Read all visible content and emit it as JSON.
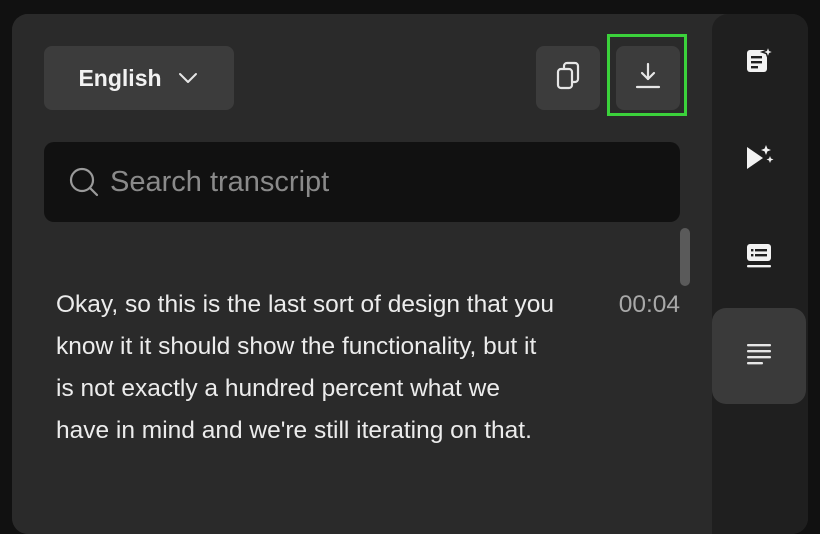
{
  "header": {
    "language_label": "English",
    "language_dropdown_icon": "chevron-down-icon",
    "copy_icon": "copy-icon",
    "download_icon": "download-icon"
  },
  "search": {
    "placeholder": "Search transcript",
    "value": "",
    "icon": "search-icon"
  },
  "transcript": {
    "entries": [
      {
        "text": "Okay, so this is the last sort of design that you know it it should show the functionality, but it is not exactly a hundred percent what we have in mind and we're still iterating on that.",
        "timestamp": "00:04"
      }
    ]
  },
  "side_rail": {
    "items": [
      {
        "icon": "ai-notes-icon",
        "active": false
      },
      {
        "icon": "ai-play-icon",
        "active": false
      },
      {
        "icon": "chapters-list-icon",
        "active": false
      },
      {
        "icon": "transcript-lines-icon",
        "active": true
      }
    ]
  },
  "colors": {
    "highlight": "#3bd13b",
    "panel_bg": "#2a2a2a",
    "rail_bg": "#1f1f1f"
  }
}
